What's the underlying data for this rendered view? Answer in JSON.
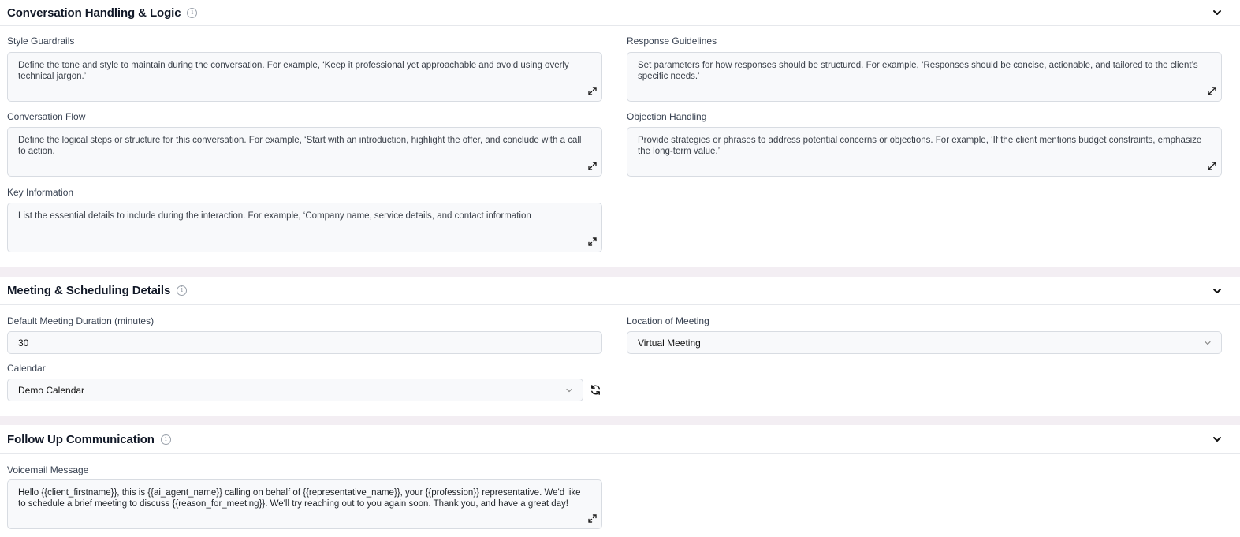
{
  "conversation": {
    "title": "Conversation Handling & Logic",
    "style_guardrails": {
      "label": "Style Guardrails",
      "text": "Define the tone and style to maintain during the conversation. For example, ‘Keep it professional yet approachable and avoid using overly technical jargon.’"
    },
    "response_guidelines": {
      "label": "Response Guidelines",
      "text": "Set parameters for how responses should be structured. For example, ‘Responses should be concise, actionable, and tailored to the client’s specific needs.’"
    },
    "conversation_flow": {
      "label": "Conversation Flow",
      "text": "Define the logical steps or structure for this conversation. For example, ‘Start with an introduction, highlight the offer, and conclude with a call to action."
    },
    "objection_handling": {
      "label": "Objection Handling",
      "text": "Provide strategies or phrases to address potential concerns or objections. For example, ‘If the client mentions budget constraints, emphasize the long-term value.’"
    },
    "key_information": {
      "label": "Key Information",
      "text": "List the essential details to include during the interaction. For example, ‘Company name, service details, and contact information"
    }
  },
  "meeting": {
    "title": "Meeting & Scheduling Details",
    "duration": {
      "label": "Default Meeting Duration (minutes)",
      "value": "30"
    },
    "location": {
      "label": "Location of Meeting",
      "value": "Virtual Meeting"
    },
    "calendar": {
      "label": "Calendar",
      "value": "Demo Calendar"
    }
  },
  "followup": {
    "title": "Follow Up Communication",
    "voicemail": {
      "label": "Voicemail Message",
      "text": "Hello {{client_firstname}}, this is {{ai_agent_name}} calling on behalf of {{representative_name}}, your {{profession}} representative. We'd like to schedule a brief meeting to discuss {{reason_for_meeting}}. We'll try reaching out to you again soon. Thank you, and have a great day!"
    }
  },
  "icons": {
    "info": "info-icon",
    "chevron": "chevron-down-icon",
    "expand": "expand-icon",
    "refresh": "refresh-icon"
  }
}
